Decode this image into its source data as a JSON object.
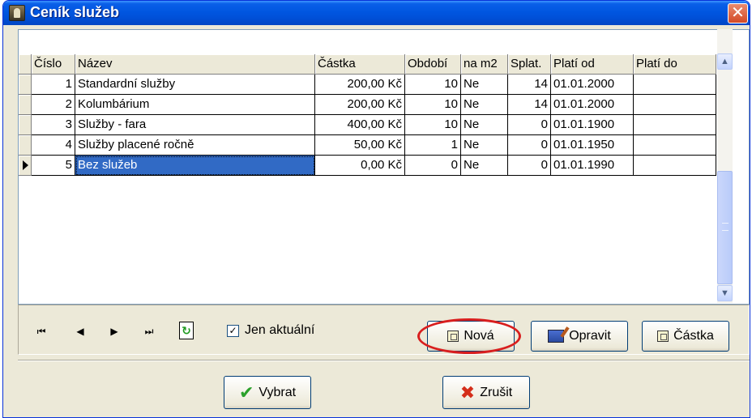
{
  "window": {
    "title": "Ceník služeb",
    "close_glyph": "✕"
  },
  "grid": {
    "columns": [
      "Číslo",
      "Název",
      "Částka",
      "Období",
      "na m2",
      "Splat.",
      "Platí od",
      "Platí do"
    ],
    "rows": [
      {
        "cislo": "1",
        "nazev": "Standardní služby",
        "castka": "200,00 Kč",
        "obdobi": "10",
        "na_m2": "Ne",
        "splat": "14",
        "plati_od": "01.01.2000",
        "plati_do": ""
      },
      {
        "cislo": "2",
        "nazev": "Kolumbárium",
        "castka": "200,00 Kč",
        "obdobi": "10",
        "na_m2": "Ne",
        "splat": "14",
        "plati_od": "01.01.2000",
        "plati_do": ""
      },
      {
        "cislo": "3",
        "nazev": "Služby - fara",
        "castka": "400,00 Kč",
        "obdobi": "10",
        "na_m2": "Ne",
        "splat": "0",
        "plati_od": "01.01.1900",
        "plati_do": ""
      },
      {
        "cislo": "4",
        "nazev": "Služby placené ročně",
        "castka": "50,00 Kč",
        "obdobi": "1",
        "na_m2": "Ne",
        "splat": "0",
        "plati_od": "01.01.1950",
        "plati_do": ""
      },
      {
        "cislo": "5",
        "nazev": "Bez služeb",
        "castka": "0,00 Kč",
        "obdobi": "0",
        "na_m2": "Ne",
        "splat": "0",
        "plati_od": "01.01.1990",
        "plati_do": ""
      }
    ],
    "selected_row": 5
  },
  "navigator": {
    "first": "⏮",
    "prev": "◀",
    "next": "▶",
    "last": "⏭",
    "refresh": "↻"
  },
  "filter": {
    "label": "Jen aktuální",
    "checked": true,
    "check_glyph": "✓"
  },
  "buttons": {
    "nova": "Nová",
    "opravit": "Opravit",
    "castka": "Částka",
    "vybrat": "Vybrat",
    "zrusit": "Zrušit",
    "check_glyph": "✔",
    "x_glyph": "✖"
  },
  "scroll": {
    "up": "▲",
    "down": "▼"
  },
  "colors": {
    "titlebar": "#0054e3",
    "selection": "#316ac5",
    "highlight_oval": "#d81e1e"
  }
}
